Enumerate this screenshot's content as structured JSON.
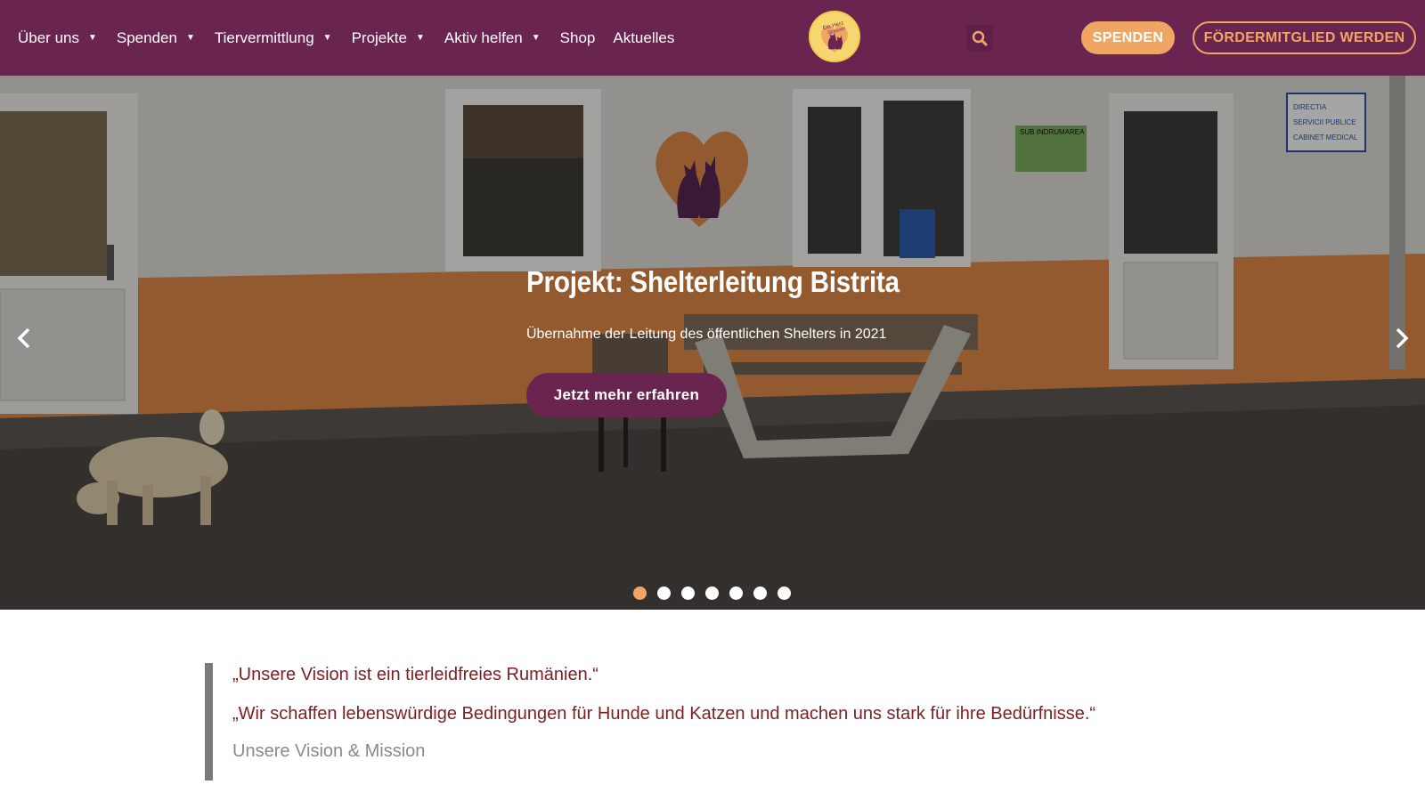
{
  "nav": {
    "items": [
      {
        "label": "Über uns",
        "dropdown": true
      },
      {
        "label": "Spenden",
        "dropdown": true
      },
      {
        "label": "Tiervermittlung",
        "dropdown": true
      },
      {
        "label": "Projekte",
        "dropdown": true
      },
      {
        "label": "Aktiv helfen",
        "dropdown": true
      },
      {
        "label": "Shop",
        "dropdown": false
      },
      {
        "label": "Aktuelles",
        "dropdown": false
      }
    ],
    "logo_text": "Ein Herz für Streuner",
    "buttons": {
      "donate": "SPENDEN",
      "member": "FÖRDERMITGLIED WERDEN"
    }
  },
  "hero": {
    "title": "Projekt: Shelterleitung Bistrita",
    "subtitle": "Übernahme der Leitung des öffentlichen Shelters in 2021",
    "cta": "Jetzt mehr erfahren",
    "slides_total": 7,
    "active_slide": 1,
    "wall_sign_1": "SUB INDRUMAREA",
    "wall_sign_2": "DIRECTIA SERVICII PUBLICE CABINET MEDICAL"
  },
  "quote": {
    "line1": "„Unsere Vision ist ein tierleidfreies Rumänien.“",
    "line2": "„Wir schaffen lebenswürdige Bedingungen für Hunde und Katzen und machen uns stark für ihre Bedürfnisse.“",
    "cite": "Unsere Vision & Mission"
  },
  "colors": {
    "primary": "#6a2450",
    "accent": "#f0a662",
    "quote_text": "#7b1f22"
  },
  "icons": [
    "caret-down-icon",
    "search-icon",
    "chevron-left-icon",
    "chevron-right-icon"
  ]
}
